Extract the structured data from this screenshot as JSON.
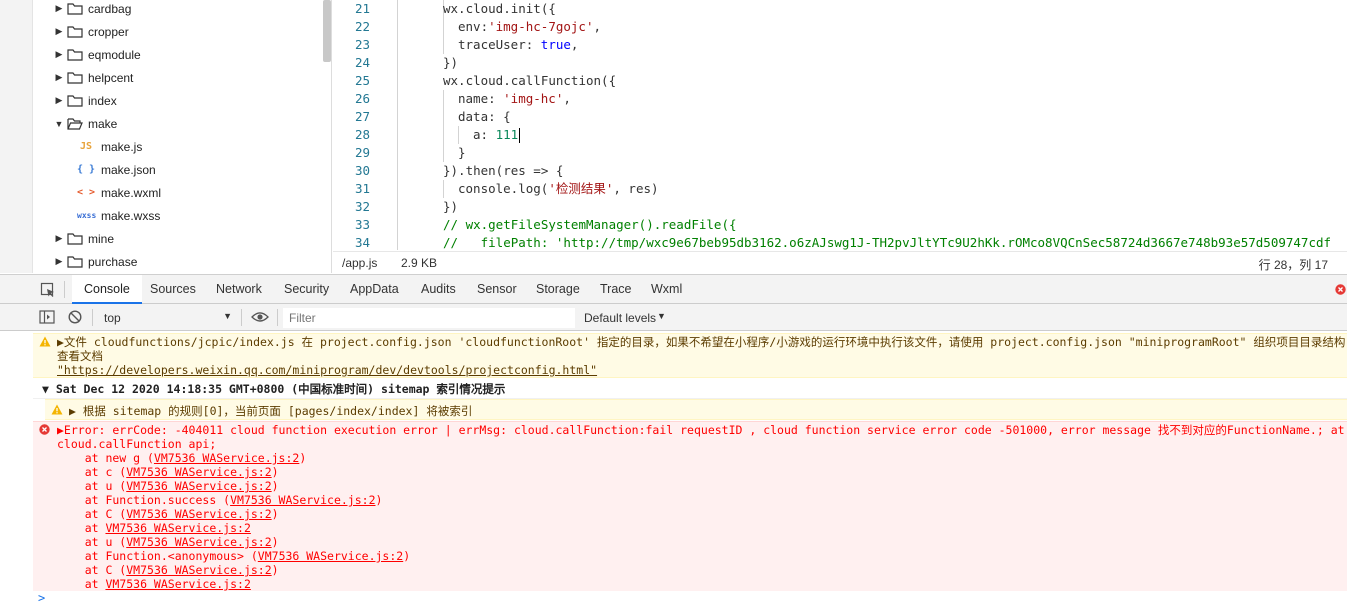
{
  "tree": {
    "folders_top": [
      "cardbag",
      "cropper",
      "eqmodule",
      "helpcent",
      "index",
      "make"
    ],
    "make_files": [
      {
        "icon": "JS",
        "name": "make.js",
        "color": "#e8a33a"
      },
      {
        "icon": "{ }",
        "name": "make.json",
        "color": "#3a7bd5"
      },
      {
        "icon": "< >",
        "name": "make.wxml",
        "color": "#e55c2f"
      },
      {
        "icon": "wxss",
        "name": "make.wxss",
        "color": "#3a6fd5"
      }
    ],
    "folders_bottom": [
      "mine",
      "purchase"
    ]
  },
  "editor": {
    "line_numbers": [
      "21",
      "22",
      "23",
      "24",
      "25",
      "26",
      "27",
      "28",
      "29",
      "30",
      "31",
      "32",
      "33",
      "34"
    ],
    "lines": {
      "l21": "wx.cloud.init({",
      "l22a": "env:",
      "l22b": "'img-hc-7gojc'",
      "l22c": ",",
      "l23a": "traceUser: ",
      "l23b": "true",
      "l23c": ",",
      "l24": "})",
      "l25": "wx.cloud.callFunction({",
      "l26a": "name: ",
      "l26b": "'img-hc'",
      "l26c": ",",
      "l27": "data: {",
      "l28a": "a: ",
      "l28b": "111",
      "l29": "}",
      "l30": "}).then(res => {",
      "l31a": "console.log(",
      "l31b": "'检测结果'",
      "l31c": ", res)",
      "l32": "})",
      "l33": "// wx.getFileSystemManager().readFile({",
      "l34a": "//   filePath: ",
      "l34b": "'http://tmp/wxc9e67beb95db3162.o6zAJswg1J-TH2pvJltYTc9U2hKk.rOMco8VQCnSec58724d3667e748b93e57d509747cdf"
    }
  },
  "status": {
    "file": "/app.js",
    "size": "2.9 KB",
    "position": "行 28，列 17"
  },
  "devtools": {
    "tabs": [
      "Console",
      "Sources",
      "Network",
      "Security",
      "AppData",
      "Audits",
      "Sensor",
      "Storage",
      "Trace",
      "Wxml"
    ],
    "context": "top",
    "filter_placeholder": "Filter",
    "levels": "Default levels"
  },
  "console": {
    "warn1": {
      "line1": "▶文件 cloudfunctions/jcpic/index.js 在 project.config.json 'cloudfunctionRoot' 指定的目录，如果不希望在小程序/小游戏的运行环境中执行该文件，请使用 project.config.json \"miniprogramRoot\" 组织项目目录结构",
      "line2": "查看文档",
      "link": "\"https://developers.weixin.qq.com/miniprogram/dev/devtools/projectconfig.html\""
    },
    "group": "▼ Sat Dec 12 2020 14:18:35 GMT+0800 (中国标准时间) sitemap 索引情况提示",
    "warn2": "▶ 根据 sitemap 的规则[0]，当前页面 [pages/index/index] 将被索引",
    "error": {
      "line1": "▶Error: errCode: -404011 cloud function execution error | errMsg: cloud.callFunction:fail requestID , cloud function service error code -501000, error message 找不到对应的FunctionName.; at",
      "line2": "cloud.callFunction api;",
      "stack": [
        {
          "pre": "    at new g (",
          "link": "VM7536 WAService.js:2",
          "post": ")"
        },
        {
          "pre": "    at c (",
          "link": "VM7536 WAService.js:2",
          "post": ")"
        },
        {
          "pre": "    at u (",
          "link": "VM7536 WAService.js:2",
          "post": ")"
        },
        {
          "pre": "    at Function.success (",
          "link": "VM7536 WAService.js:2",
          "post": ")"
        },
        {
          "pre": "    at C (",
          "link": "VM7536 WAService.js:2",
          "post": ")"
        },
        {
          "pre": "    at ",
          "link": "VM7536 WAService.js:2",
          "post": ""
        },
        {
          "pre": "    at u (",
          "link": "VM7536 WAService.js:2",
          "post": ")"
        },
        {
          "pre": "    at Function.<anonymous> (",
          "link": "VM7536 WAService.js:2",
          "post": ")"
        },
        {
          "pre": "    at C (",
          "link": "VM7536 WAService.js:2",
          "post": ")"
        },
        {
          "pre": "    at ",
          "link": "VM7536 WAService.js:2",
          "post": ""
        }
      ]
    },
    "prompt": ">"
  }
}
